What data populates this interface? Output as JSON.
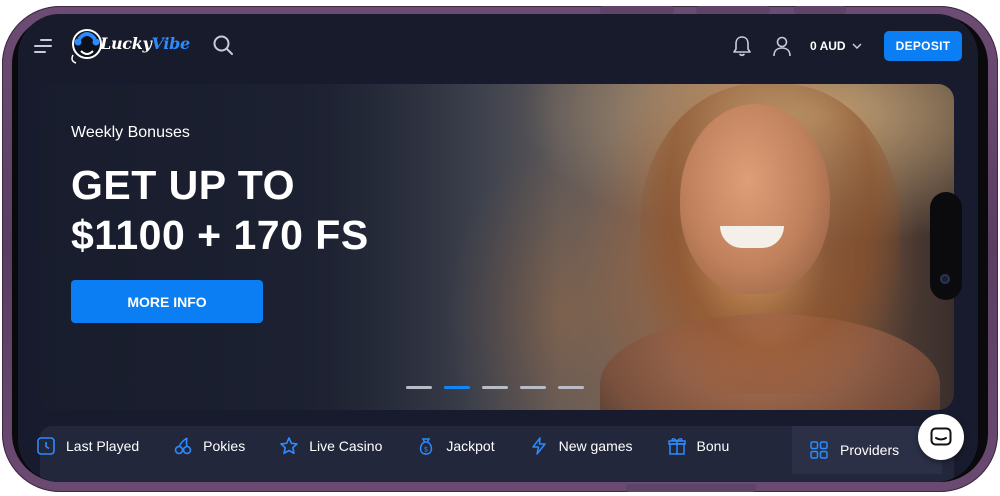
{
  "header": {
    "logo_text_main": "Lucky",
    "logo_text_accent": "Vibe",
    "currency_balance": "0 AUD",
    "deposit_label": "DEPOSIT"
  },
  "hero": {
    "subtitle": "Weekly Bonuses",
    "title_line1": "GET UP TO",
    "title_line2": "$1100 + 170 FS",
    "cta_label": "MORE INFO",
    "slides_total": 5,
    "active_slide": 2
  },
  "nav": {
    "items": [
      {
        "label": "Last Played",
        "icon": "clock-icon"
      },
      {
        "label": "Pokies",
        "icon": "cherry-icon"
      },
      {
        "label": "Live Casino",
        "icon": "star-icon"
      },
      {
        "label": "Jackpot",
        "icon": "money-bag-icon"
      },
      {
        "label": "New games",
        "icon": "lightning-icon"
      },
      {
        "label": "Bonu",
        "icon": "gift-icon"
      }
    ],
    "providers_label": "Providers"
  },
  "colors": {
    "accent": "#0a7ef2",
    "background": "#181b2d",
    "nav_bg": "#23273c",
    "icon_blue": "#2b8cff"
  }
}
